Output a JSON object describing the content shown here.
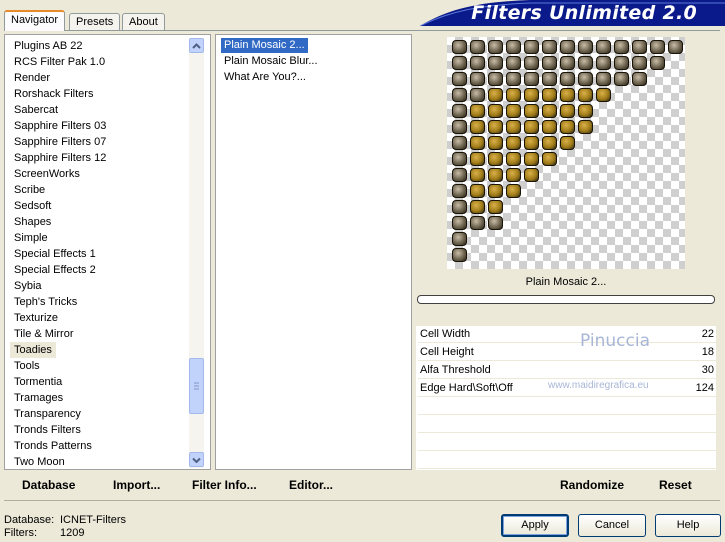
{
  "tabs": [
    {
      "label": "Navigator"
    },
    {
      "label": "Presets"
    },
    {
      "label": "About"
    }
  ],
  "banner_title": "Filters Unlimited 2.0",
  "categories": [
    "Plugins AB 22",
    "RCS Filter Pak 1.0",
    "Render",
    "Rorshack Filters",
    "Sabercat",
    "Sapphire Filters 03",
    "Sapphire Filters 07",
    "Sapphire Filters 12",
    "ScreenWorks",
    "Scribe",
    "Sedsoft",
    "Shapes",
    "Simple",
    "Special Effects 1",
    "Special Effects 2",
    "Sybia",
    "Teph's Tricks",
    "Texturize",
    "Tile & Mirror",
    "Toadies",
    "Tools",
    "Tormentia",
    "Tramages",
    "Transparency",
    "Tronds Filters",
    "Tronds Patterns",
    "Two Moon"
  ],
  "selected_category": "Toadies",
  "filters": [
    "Plain Mosaic 2...",
    "Plain Mosaic Blur...",
    "What Are You?..."
  ],
  "selected_filter": "Plain Mosaic 2...",
  "preview_caption": "Plain Mosaic 2...",
  "params": [
    {
      "label": "Cell Width",
      "value": "22"
    },
    {
      "label": "Cell Height",
      "value": "18"
    },
    {
      "label": "Alfa Threshold",
      "value": "30"
    },
    {
      "label": "Edge Hard\\Soft\\Off",
      "value": "124"
    }
  ],
  "watermark": {
    "line1": "Pinuccia",
    "line2": "www.maidiregrafica.eu"
  },
  "toolbar": {
    "database": "Database",
    "import": "Import...",
    "filter_info": "Filter Info...",
    "editor": "Editor...",
    "randomize": "Randomize",
    "reset": "Reset"
  },
  "status": {
    "database_label": "Database:",
    "database_value": "ICNET-Filters",
    "filters_label": "Filters:",
    "filters_value": "1209"
  },
  "buttons": {
    "apply": "Apply",
    "cancel": "Cancel",
    "help": "Help"
  },
  "colors": {
    "banner": "#0a1a8a",
    "selection": "#316ac5",
    "tile_dark": "#4a4030",
    "tile_gold": "#8a6a10"
  }
}
